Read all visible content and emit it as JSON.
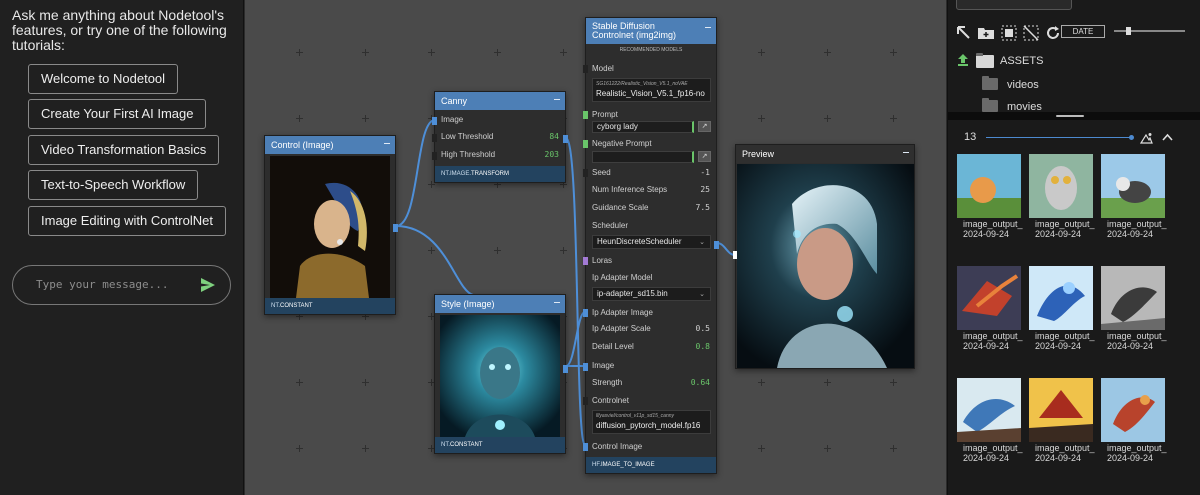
{
  "chat": {
    "intro": "Ask me anything about Nodetool's features, or try one of the following tutorials:",
    "tutorials": [
      "Welcome to Nodetool",
      "Create Your First AI Image",
      "Video Transformation Basics",
      "Text-to-Speech Workflow",
      "Image Editing with ControlNet"
    ],
    "input_placeholder": "Type your message..."
  },
  "nodes": {
    "control_image": {
      "title": "Control (Image)",
      "footer_ns": "NT.",
      "footer_type": "CONSTANT"
    },
    "canny": {
      "title": "Canny",
      "image_label": "Image",
      "low_label": "Low Threshold",
      "low_value": "84",
      "high_label": "High Threshold",
      "high_value": "203",
      "footer_ns": "NT.IMAGE.",
      "footer_type": "TRANSFORM"
    },
    "style_image": {
      "title": "Style (Image)",
      "footer_ns": "NT.",
      "footer_type": "CONSTANT"
    },
    "sd": {
      "title_line1": "Stable Diffusion",
      "title_line2": "Controlnet (img2img)",
      "recommended": "RECOMMENDED MODELS",
      "model_label": "Model",
      "model_repo": "SG161222/Realistic_Vision_V5.1_noVAE",
      "model_file": "Realistic_Vision_V5.1_fp16-no",
      "prompt_label": "Prompt",
      "prompt_value": "cyborg lady",
      "neg_label": "Negative Prompt",
      "seed_label": "Seed",
      "seed_value": "-1",
      "steps_label": "Num Inference Steps",
      "steps_value": "25",
      "guidance_label": "Guidance Scale",
      "guidance_value": "7.5",
      "scheduler_label": "Scheduler",
      "scheduler_value": "HeunDiscreteScheduler",
      "loras_label": "Loras",
      "ip_model_label": "Ip Adapter Model",
      "ip_model_value": "ip-adapter_sd15.bin",
      "ip_image_label": "Ip Adapter Image",
      "ip_scale_label": "Ip Adapter Scale",
      "ip_scale_value": "0.5",
      "detail_label": "Detail Level",
      "detail_value": "0.8",
      "image_label": "Image",
      "strength_label": "Strength",
      "strength_value": "0.64",
      "controlnet_label": "Controlnet",
      "controlnet_repo": "lllyasviel/control_v11p_sd15_canny",
      "controlnet_file": "diffusion_pytorch_model.fp16",
      "control_image_label": "Control Image",
      "footer_ns": "HF.",
      "footer_type": "IMAGE_TO_IMAGE"
    },
    "preview": {
      "title": "Preview"
    }
  },
  "assets": {
    "date_button": "DATE",
    "root": "ASSETS",
    "folders": [
      "videos",
      "movies"
    ],
    "count": "13",
    "thumbnails": [
      "image_output_2024-09-24",
      "image_output_2024-09-24",
      "image_output_2024-09-24",
      "image_output_2024-09-24",
      "image_output_2024-09-24",
      "image_output_2024-09-24",
      "image_output_2024-09-24",
      "image_output_2024-09-24",
      "image_output_2024-09-24"
    ]
  },
  "colors": {
    "node_header": "#4d7fb6",
    "node_footer": "#23435f",
    "wire": "#4e8fd8",
    "accent_green": "#6ac56a"
  }
}
